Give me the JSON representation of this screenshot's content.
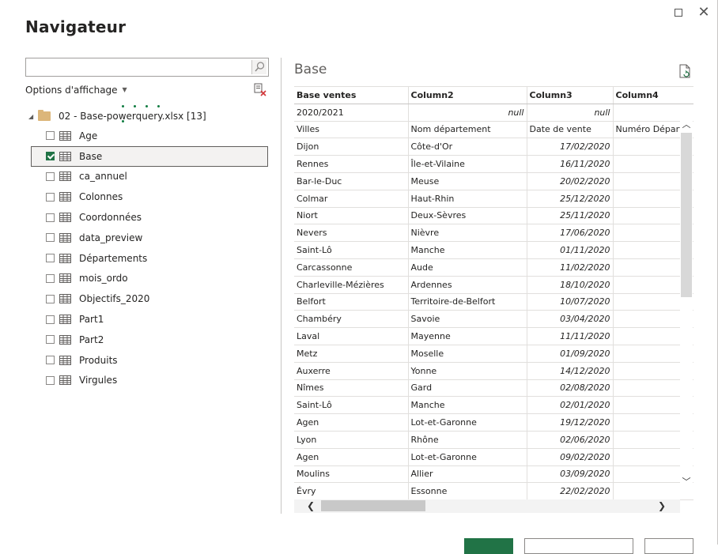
{
  "window": {
    "title": "Navigateur"
  },
  "left": {
    "search": {
      "value": "",
      "placeholder": ""
    },
    "options_label": "Options d'affichage",
    "root": {
      "label": "02 - Base-powerquery.xlsx [13]"
    },
    "items": [
      {
        "label": "Age",
        "checked": false
      },
      {
        "label": "Base",
        "checked": true
      },
      {
        "label": "ca_annuel",
        "checked": false
      },
      {
        "label": "Colonnes",
        "checked": false
      },
      {
        "label": "Coordonnées",
        "checked": false
      },
      {
        "label": "data_preview",
        "checked": false
      },
      {
        "label": "Départements",
        "checked": false
      },
      {
        "label": "mois_ordo",
        "checked": false
      },
      {
        "label": "Objectifs_2020",
        "checked": false
      },
      {
        "label": "Part1",
        "checked": false
      },
      {
        "label": "Part2",
        "checked": false
      },
      {
        "label": "Produits",
        "checked": false
      },
      {
        "label": "Virgules",
        "checked": false
      }
    ]
  },
  "preview": {
    "title": "Base",
    "columns": [
      "Base ventes",
      "Column2",
      "Column3",
      "Column4"
    ],
    "rows": [
      [
        "2020/2021",
        "null",
        "null",
        ""
      ],
      [
        "Villes",
        "Nom département",
        "Date de vente",
        "Numéro Départe"
      ],
      [
        "Dijon",
        "Côte-d'Or",
        "17/02/2020",
        ""
      ],
      [
        "Rennes",
        "Île-et-Vilaine",
        "16/11/2020",
        ""
      ],
      [
        "Bar-le-Duc",
        "Meuse",
        "20/02/2020",
        ""
      ],
      [
        "Colmar",
        "Haut-Rhin",
        "25/12/2020",
        ""
      ],
      [
        "Niort",
        "Deux-Sèvres",
        "25/11/2020",
        ""
      ],
      [
        "Nevers",
        "Nièvre",
        "17/06/2020",
        ""
      ],
      [
        "Saint-Lô",
        "Manche",
        "01/11/2020",
        ""
      ],
      [
        "Carcassonne",
        "Aude",
        "11/02/2020",
        ""
      ],
      [
        "Charleville-Mézières",
        "Ardennes",
        "18/10/2020",
        ""
      ],
      [
        "Belfort",
        "Territoire-de-Belfort",
        "10/07/2020",
        ""
      ],
      [
        "Chambéry",
        "Savoie",
        "03/04/2020",
        ""
      ],
      [
        "Laval",
        "Mayenne",
        "11/11/2020",
        ""
      ],
      [
        "Metz",
        "Moselle",
        "01/09/2020",
        ""
      ],
      [
        "Auxerre",
        "Yonne",
        "14/12/2020",
        ""
      ],
      [
        "Nîmes",
        "Gard",
        "02/08/2020",
        ""
      ],
      [
        "Saint-Lô",
        "Manche",
        "02/01/2020",
        ""
      ],
      [
        "Agen",
        "Lot-et-Garonne",
        "19/12/2020",
        ""
      ],
      [
        "Lyon",
        "Rhône",
        "02/06/2020",
        ""
      ],
      [
        "Agen",
        "Lot-et-Garonne",
        "09/02/2020",
        ""
      ],
      [
        "Moulins",
        "Allier",
        "03/09/2020",
        ""
      ],
      [
        "Évry",
        "Essonne",
        "22/02/2020",
        ""
      ]
    ]
  },
  "colors": {
    "accent": "#217346",
    "folder": "#dcb67a"
  },
  "icons": [
    "search-icon",
    "refresh-icon",
    "folder-icon",
    "table-icon",
    "export-icon"
  ]
}
